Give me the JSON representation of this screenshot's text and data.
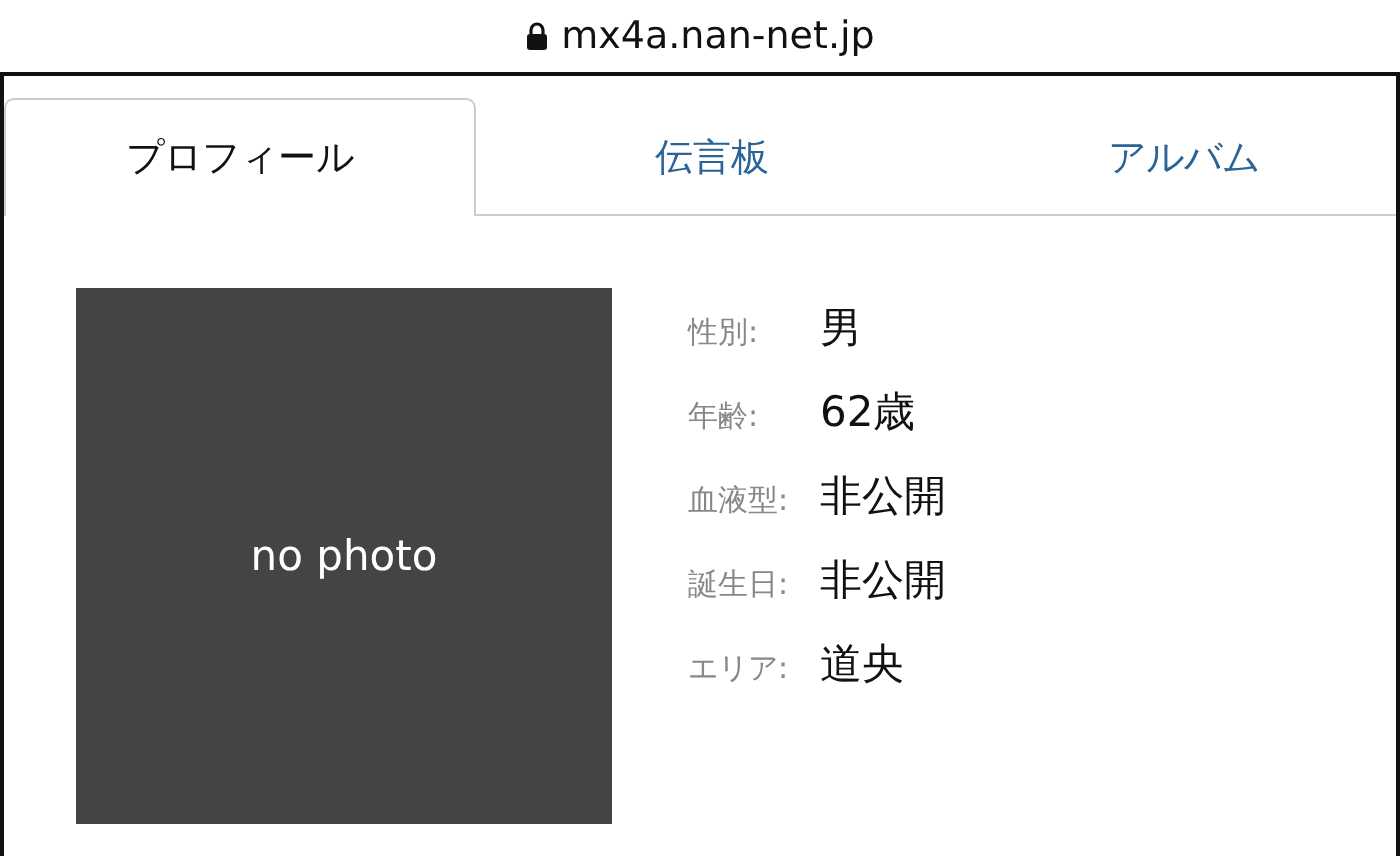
{
  "address_bar": {
    "url": "mx4a.nan-net.jp"
  },
  "tabs": [
    {
      "label": "プロフィール",
      "selected": true
    },
    {
      "label": "伝言板",
      "selected": false
    },
    {
      "label": "アルバム",
      "selected": false
    }
  ],
  "photo": {
    "text": "no photo"
  },
  "profile": [
    {
      "label": "性別:",
      "value": "男"
    },
    {
      "label": "年齢:",
      "value": "62歳"
    },
    {
      "label": "血液型:",
      "value": "非公開"
    },
    {
      "label": "誕生日:",
      "value": "非公開"
    },
    {
      "label": "エリア:",
      "value": "道央"
    }
  ]
}
